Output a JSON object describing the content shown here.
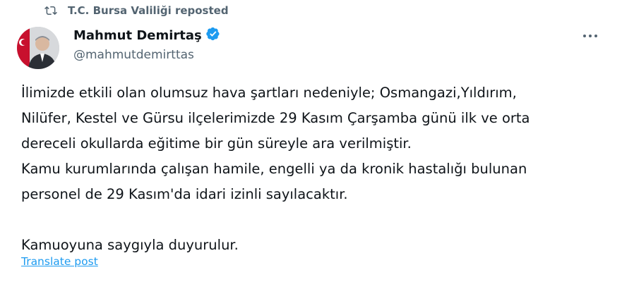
{
  "repost": {
    "icon": "repost-icon",
    "text": "T.C. Bursa Valiliği reposted"
  },
  "author": {
    "name": "Mahmut Demirtaş",
    "handle": "@mahmutdemirttas",
    "verified_icon": "verified-badge-icon",
    "verified_color": "#1d9bf0"
  },
  "menu": {
    "icon": "more-options-icon"
  },
  "post": {
    "line1": "İlimizde etkili olan olumsuz hava şartları nedeniyle; Osmangazi,Yıldırım,",
    "line2": "Nilüfer, Kestel ve Gürsu ilçelerimizde 29 Kasım Çarşamba günü ilk ve orta",
    "line3": "dereceli okullarda eğitime bir gün süreyle ara verilmiştir.",
    "line4": "Kamu kurumlarında çalışan hamile, engelli ya da kronik hastalığı bulunan",
    "line5": "personel de 29 Kasım'da idari izinli sayılacaktır.",
    "line6": "Kamuoyuna saygıyla duyurulur."
  },
  "translate_label": "Translate post"
}
